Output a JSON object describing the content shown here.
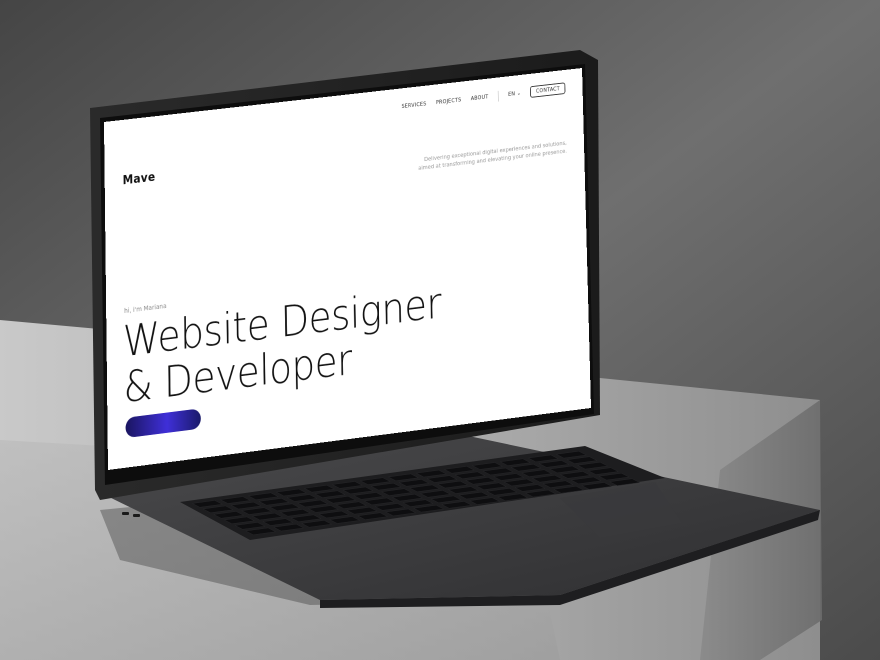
{
  "site": {
    "logo": "Mave",
    "nav": {
      "items": [
        "SERVICES",
        "PROJECTS",
        "ABOUT"
      ],
      "language": "EN",
      "contact_label": "CONTACT"
    },
    "tagline": "Delivering exceptional digital experiences and solutions, aimed at transforming and elevating your online presence.",
    "greeting": "hi, i'm Mariana",
    "headline_line1": "Website Designer",
    "headline_line2": "& Developer",
    "cta_label": ""
  },
  "colors": {
    "background": "#5e5e5e",
    "laptop_body": "#3c3c3e",
    "bezel": "#141414",
    "cta_gradient_start": "#1a1560",
    "cta_gradient_mid": "#3f2fd8"
  }
}
